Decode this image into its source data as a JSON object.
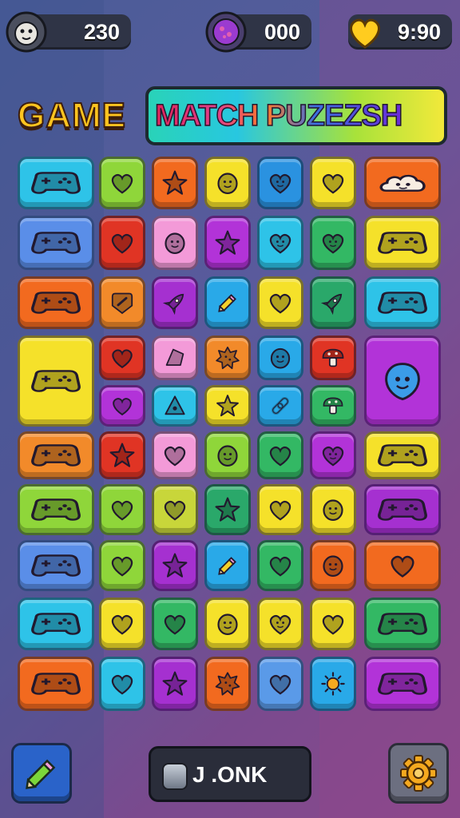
{
  "hud": {
    "score": "230",
    "gems": "000",
    "time": "9:90",
    "icons": [
      "creature-face-icon",
      "purple-gem-icon",
      "heart-icon"
    ]
  },
  "title": {
    "left_text": "GAME",
    "banner_text": "MATCH PUZEZSH"
  },
  "board": {
    "columns": 7,
    "tiles": [
      {
        "row": 0,
        "col": 0,
        "span": "wide",
        "color": "#2ec3e8",
        "icon": "gamepad"
      },
      {
        "row": 0,
        "col": 1,
        "color": "#8fd63a",
        "icon": "heart"
      },
      {
        "row": 0,
        "col": 2,
        "color": "#f26a1f",
        "icon": "star"
      },
      {
        "row": 0,
        "col": 3,
        "color": "#f5e12a",
        "icon": "blob-face"
      },
      {
        "row": 0,
        "col": 4,
        "color": "#2a92e0",
        "icon": "heart-face"
      },
      {
        "row": 0,
        "col": 5,
        "color": "#f5e12a",
        "icon": "heart"
      },
      {
        "row": 0,
        "col": 6,
        "span": "wide",
        "color": "#f26a1f",
        "icon": "cloud-face"
      },
      {
        "row": 1,
        "col": 0,
        "span": "wide",
        "color": "#5a8ee8",
        "icon": "gamepad"
      },
      {
        "row": 1,
        "col": 1,
        "color": "#e03424",
        "icon": "heart"
      },
      {
        "row": 1,
        "col": 2,
        "color": "#f39ad8",
        "icon": "blob-face"
      },
      {
        "row": 1,
        "col": 3,
        "color": "#b233d8",
        "icon": "star"
      },
      {
        "row": 1,
        "col": 4,
        "color": "#2ec3e8",
        "icon": "heart-face"
      },
      {
        "row": 1,
        "col": 5,
        "color": "#33b864",
        "icon": "heart-face"
      },
      {
        "row": 1,
        "col": 6,
        "span": "wide",
        "color": "#f5e12a",
        "icon": "gamepad"
      },
      {
        "row": 2,
        "col": 0,
        "span": "wide",
        "color": "#f26a1f",
        "icon": "gamepad"
      },
      {
        "row": 2,
        "col": 1,
        "color": "#f28a2a",
        "icon": "bandage"
      },
      {
        "row": 2,
        "col": 2,
        "color": "#a530d0",
        "icon": "rocket"
      },
      {
        "row": 2,
        "col": 3,
        "color": "#29a9e8",
        "icon": "pencil"
      },
      {
        "row": 2,
        "col": 4,
        "color": "#f5e12a",
        "icon": "heart"
      },
      {
        "row": 2,
        "col": 5,
        "color": "#2aa86a",
        "icon": "rocket"
      },
      {
        "row": 2,
        "col": 6,
        "span": "wide",
        "color": "#2ec3e8",
        "icon": "gamepad"
      },
      {
        "row": 3,
        "col": 0,
        "span": "big",
        "color": "#f5e12a",
        "icon": "gamepad"
      },
      {
        "row": 3,
        "col": 1,
        "color": "#e03424",
        "icon": "heart"
      },
      {
        "row": 3,
        "col": 2,
        "color": "#f39ad8",
        "icon": "shard"
      },
      {
        "row": 3,
        "col": 3,
        "color": "#f28a2a",
        "icon": "cookie"
      },
      {
        "row": 3,
        "col": 4,
        "color": "#29a9e8",
        "icon": "blob-face"
      },
      {
        "row": 3,
        "col": 5,
        "color": "#e03424",
        "icon": "mushroom"
      },
      {
        "row": 3,
        "col": 6,
        "span": "big",
        "color": "#b233d8",
        "icon": "balloon-face"
      },
      {
        "row": 4,
        "col": 1,
        "color": "#b233d8",
        "icon": "heart"
      },
      {
        "row": 4,
        "col": 2,
        "color": "#2ec3e8",
        "icon": "triangle"
      },
      {
        "row": 4,
        "col": 3,
        "color": "#f5e12a",
        "icon": "star"
      },
      {
        "row": 4,
        "col": 4,
        "color": "#29a9e8",
        "icon": "link"
      },
      {
        "row": 4,
        "col": 5,
        "color": "#33b864",
        "icon": "mushroom"
      },
      {
        "row": 5,
        "col": 0,
        "span": "wide",
        "color": "#f28a2a",
        "icon": "gamepad"
      },
      {
        "row": 5,
        "col": 1,
        "color": "#e03424",
        "icon": "star"
      },
      {
        "row": 5,
        "col": 2,
        "color": "#f39ad8",
        "icon": "heart"
      },
      {
        "row": 5,
        "col": 3,
        "color": "#8fd63a",
        "icon": "smiley"
      },
      {
        "row": 5,
        "col": 4,
        "color": "#33b864",
        "icon": "heart"
      },
      {
        "row": 5,
        "col": 5,
        "color": "#b233d8",
        "icon": "heart-face"
      },
      {
        "row": 5,
        "col": 6,
        "span": "wide",
        "color": "#f5e12a",
        "icon": "gamepad"
      },
      {
        "row": 6,
        "col": 0,
        "span": "wide",
        "color": "#8fd63a",
        "icon": "gamepad"
      },
      {
        "row": 6,
        "col": 1,
        "color": "#8fd63a",
        "icon": "heart"
      },
      {
        "row": 6,
        "col": 2,
        "color": "#c8d63a",
        "icon": "heart"
      },
      {
        "row": 6,
        "col": 3,
        "color": "#2aa86a",
        "icon": "star"
      },
      {
        "row": 6,
        "col": 4,
        "color": "#f5e12a",
        "icon": "heart"
      },
      {
        "row": 6,
        "col": 5,
        "color": "#f5e12a",
        "icon": "blob-face"
      },
      {
        "row": 6,
        "col": 6,
        "span": "wide",
        "color": "#a530d0",
        "icon": "gamepad"
      },
      {
        "row": 7,
        "col": 0,
        "span": "wide",
        "color": "#5a8ee8",
        "icon": "gamepad"
      },
      {
        "row": 7,
        "col": 1,
        "color": "#8fd63a",
        "icon": "heart"
      },
      {
        "row": 7,
        "col": 2,
        "color": "#a530d0",
        "icon": "star"
      },
      {
        "row": 7,
        "col": 3,
        "color": "#29a9e8",
        "icon": "pencil"
      },
      {
        "row": 7,
        "col": 4,
        "color": "#33b864",
        "icon": "heart"
      },
      {
        "row": 7,
        "col": 5,
        "color": "#f26a1f",
        "icon": "blob-face"
      },
      {
        "row": 7,
        "col": 6,
        "span": "wide",
        "color": "#f26a1f",
        "icon": "heart"
      },
      {
        "row": 8,
        "col": 0,
        "span": "wide",
        "color": "#2ec3e8",
        "icon": "gamepad"
      },
      {
        "row": 8,
        "col": 1,
        "color": "#f5e12a",
        "icon": "heart"
      },
      {
        "row": 8,
        "col": 2,
        "color": "#33b864",
        "icon": "heart"
      },
      {
        "row": 8,
        "col": 3,
        "color": "#f5e12a",
        "icon": "blob-face"
      },
      {
        "row": 8,
        "col": 4,
        "color": "#f5e12a",
        "icon": "heart-face"
      },
      {
        "row": 8,
        "col": 5,
        "color": "#f5e12a",
        "icon": "heart"
      },
      {
        "row": 8,
        "col": 6,
        "span": "wide",
        "color": "#33b864",
        "icon": "gamepad"
      },
      {
        "row": 9,
        "col": 0,
        "span": "wide",
        "color": "#f26a1f",
        "icon": "gamepad"
      },
      {
        "row": 9,
        "col": 1,
        "color": "#2ec3e8",
        "icon": "heart"
      },
      {
        "row": 9,
        "col": 2,
        "color": "#a530d0",
        "icon": "star"
      },
      {
        "row": 9,
        "col": 3,
        "color": "#f26a1f",
        "icon": "splat"
      },
      {
        "row": 9,
        "col": 4,
        "color": "#5a9ae8",
        "icon": "heart"
      },
      {
        "row": 9,
        "col": 5,
        "color": "#29a9e8",
        "icon": "sun"
      },
      {
        "row": 9,
        "col": 6,
        "span": "wide",
        "color": "#b233d8",
        "icon": "gamepad"
      }
    ]
  },
  "bottom": {
    "center_label": "J .ONK",
    "left_icon": "pencil-icon",
    "right_icon": "gear-icon"
  }
}
